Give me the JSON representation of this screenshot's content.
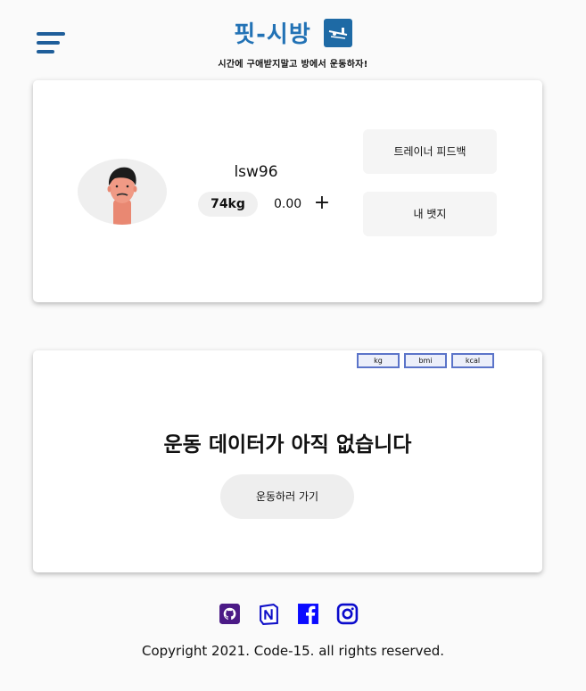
{
  "header": {
    "title": "핏-시방",
    "subtitle": "시간에 구애받지말고 방에서 운동하자!",
    "logo_icon": "bench-press-icon",
    "menu_icon": "hamburger-menu-icon",
    "brand_color": "#2272b5"
  },
  "profile": {
    "username": "lsw96",
    "weight": "74kg",
    "bmi": "0.00",
    "add_label": "+",
    "feedback_button": "트레이너 피드백",
    "badge_button": "내 뱃지",
    "avatar_icon": "user-avatar"
  },
  "data_panel": {
    "tabs": [
      {
        "label": "kg"
      },
      {
        "label": "bmi"
      },
      {
        "label": "kcal"
      }
    ],
    "empty_message": "운동 데이터가 아직 없습니다",
    "go_button": "운동하러 가기"
  },
  "footer": {
    "socials": [
      {
        "icon": "github-icon",
        "color": "#4b1a86"
      },
      {
        "icon": "notion-icon",
        "color": "#1010c8"
      },
      {
        "icon": "facebook-icon",
        "color": "#0a0aff"
      },
      {
        "icon": "instagram-icon",
        "color": "#0a0acc"
      }
    ],
    "copyright": "Copyright 2021. Code-15. all rights reserved."
  }
}
